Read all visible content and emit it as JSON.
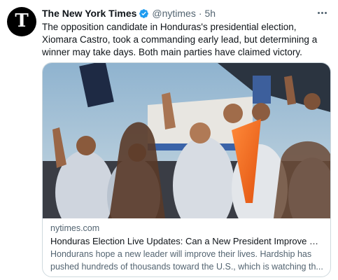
{
  "tweet": {
    "author": {
      "name": "The New York Times",
      "handle": "@nytimes",
      "avatar_letter": "T",
      "verified": true
    },
    "separator": "·",
    "time": "5h",
    "text": "The opposition candidate in Honduras's presidential election, Xiomara Castro, took a commanding early lead, but determining a winner may take days. Both main parties have claimed victory.",
    "card": {
      "image_icon": "rally-crowd-photo",
      "domain": "nytimes.com",
      "title": "Honduras Election Live Updates: Can a New President Improve Dire C...",
      "description": "Hondurans hope a new leader will improve their lives. Hardship has pushed hundreds of thousands toward the U.S., which is watching th..."
    }
  },
  "colors": {
    "verified_blue": "#1d9bf0",
    "secondary_text": "#536471",
    "border": "#cfd9de"
  }
}
